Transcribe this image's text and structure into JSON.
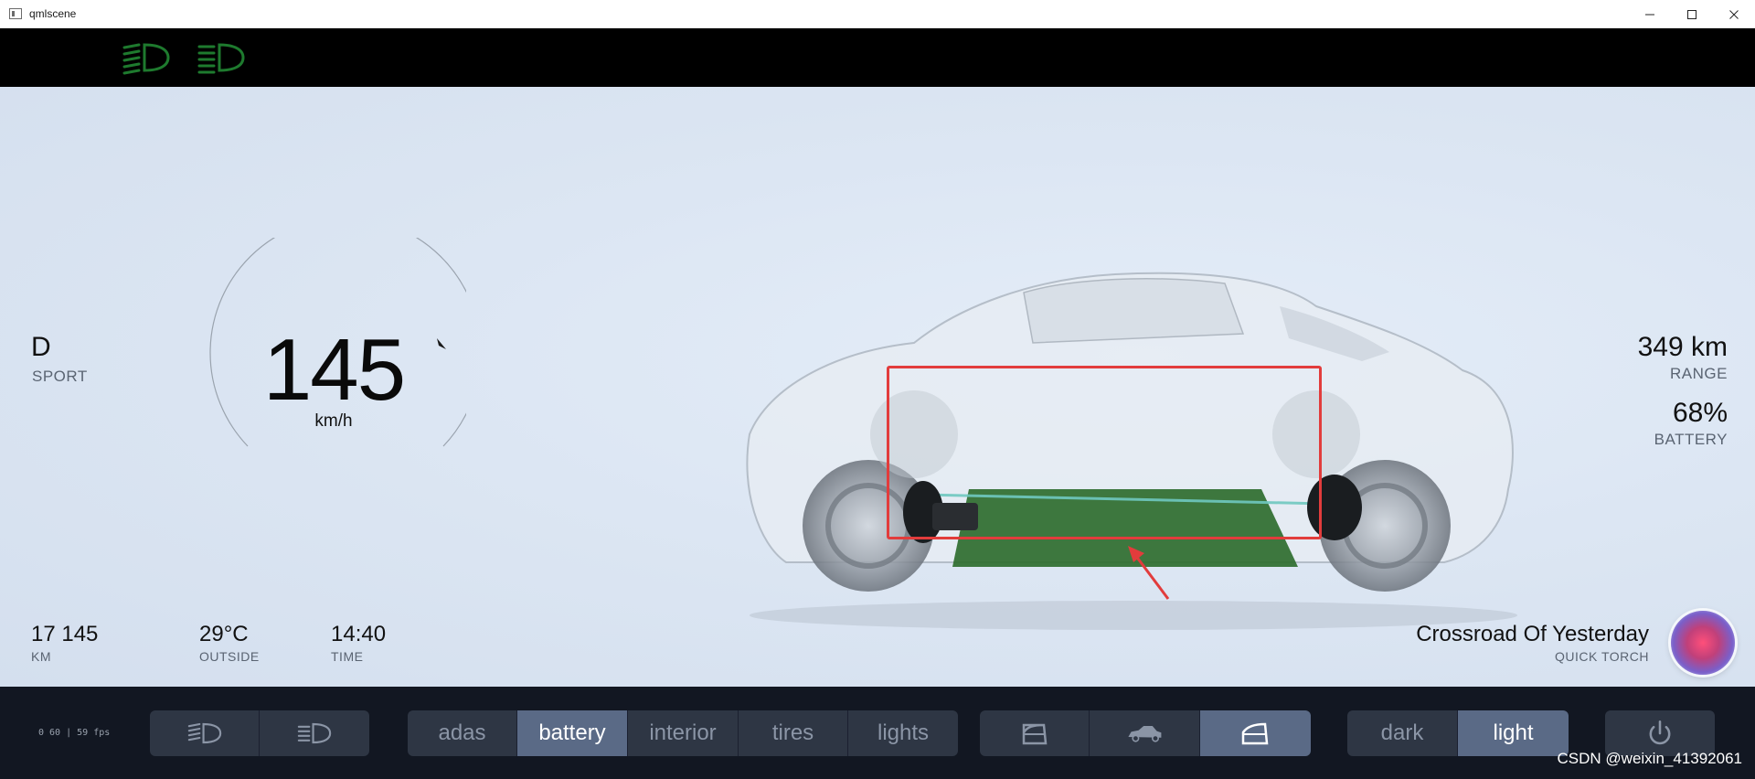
{
  "window": {
    "title": "qmlscene"
  },
  "drive": {
    "gear": "D",
    "mode": "SPORT",
    "speed": "145",
    "speed_unit": "km/h"
  },
  "stats_right": [
    {
      "value": "349 km",
      "label": "RANGE"
    },
    {
      "value": "68%",
      "label": "BATTERY"
    }
  ],
  "stats_bottom": [
    {
      "value": "17 145",
      "label": "KM"
    },
    {
      "value": "29°C",
      "label": "OUTSIDE"
    },
    {
      "value": "14:40",
      "label": "TIME"
    }
  ],
  "media": {
    "title": "Crossroad Of Yesterday",
    "artist": "QUICK TORCH"
  },
  "fps": "0 60 | 59 fps",
  "lights_group": [
    {
      "icon": "low-beam-icon"
    },
    {
      "icon": "high-beam-icon"
    }
  ],
  "view_tabs": [
    {
      "label": "adas",
      "active": false
    },
    {
      "label": "battery",
      "active": true
    },
    {
      "label": "interior",
      "active": false
    },
    {
      "label": "tires",
      "active": false
    },
    {
      "label": "lights",
      "active": false
    }
  ],
  "door_group": [
    {
      "icon": "door-icon",
      "active": false
    },
    {
      "icon": "car-side-icon",
      "active": false
    },
    {
      "icon": "door-open-icon",
      "active": true
    }
  ],
  "theme_tabs": [
    {
      "label": "dark",
      "active": false
    },
    {
      "label": "light",
      "active": true
    }
  ],
  "power": {
    "icon": "power-icon"
  },
  "watermark": "CSDN @weixin_41392061",
  "colors": {
    "accent_active": "#5a6a86",
    "segment_bg": "#2e3644",
    "bar_bg": "#121722",
    "lamp_green": "#1e7a2e",
    "battery_green": "#2a6a2a",
    "highlight_red": "#e23c3c"
  }
}
